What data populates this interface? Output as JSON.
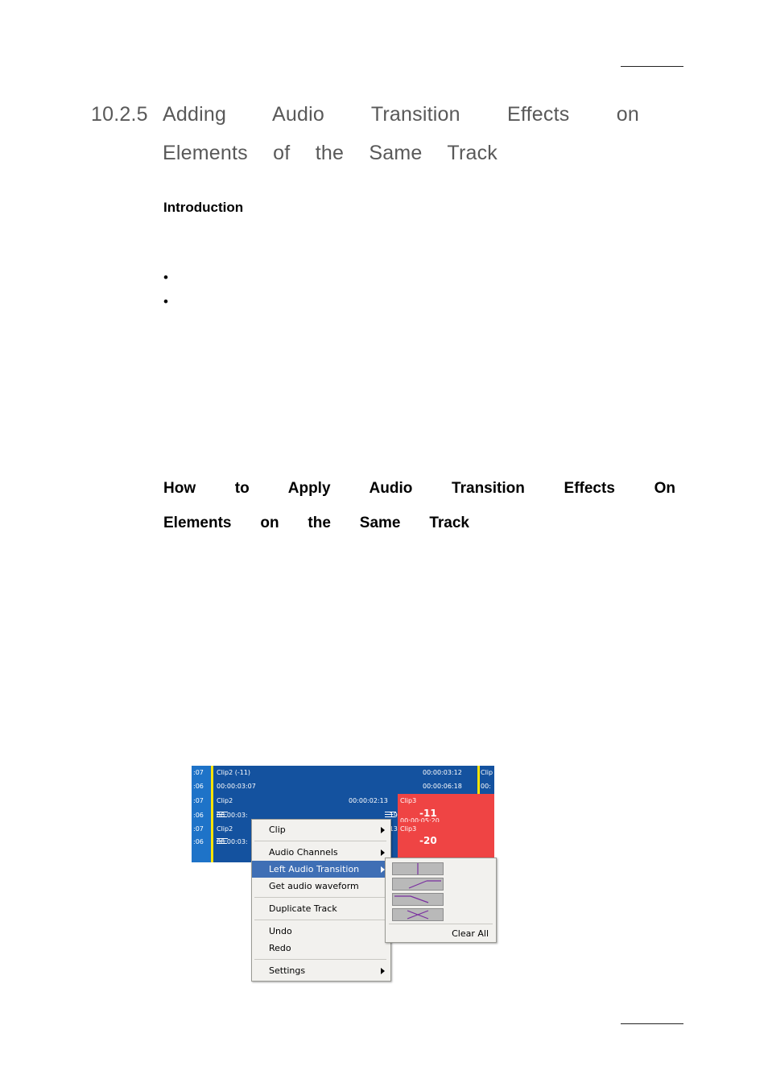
{
  "page": {
    "heading": {
      "number": "10.2.5",
      "line1": "Adding Audio Transition Effects on",
      "line2": "Elements of the Same Track"
    },
    "introduction_label": "Introduction",
    "bullets": [
      "",
      ""
    ],
    "howto": {
      "line1": "How to Apply Audio Transition Effects On",
      "line2": "Elements on the Same Track"
    }
  },
  "figure": {
    "timeline": {
      "row1": {
        "left_time": ":07",
        "clip_label": "Clip2 (-11)",
        "right_time": "00:00:03:12",
        "far_right": "Clip"
      },
      "row2": {
        "left_time": ":06",
        "mid_time": "00:00:03:07",
        "right_time": "00:00:06:18",
        "far_right": "00:"
      },
      "row3": {
        "left_time": ":07",
        "clip_label": "Clip2",
        "right_time": "00:00:02:13",
        "red_label": "Clip3"
      },
      "row4": {
        "left_time": ":06",
        "mid_time": "00:00:03:",
        "right_time": ":19",
        "red_value": "-11",
        "red_time": "00:00:05:20"
      },
      "row5": {
        "left_time": ":07",
        "clip_label": "Clip2",
        "right_time": ":13",
        "red_label": "Clip3"
      },
      "row6": {
        "left_time": ":06",
        "mid_time": "00:00:03:",
        "red_value": "-20"
      }
    },
    "context_menu": {
      "items": [
        {
          "label": "Clip",
          "submenu": true,
          "highlighted": false
        },
        {
          "label": "Audio Channels",
          "submenu": true,
          "highlighted": false
        },
        {
          "label": "Left Audio Transition",
          "submenu": true,
          "highlighted": true
        },
        {
          "label": "Get audio waveform",
          "submenu": false,
          "highlighted": false
        },
        {
          "label": "Duplicate Track",
          "submenu": false,
          "highlighted": false
        },
        {
          "label": "Undo",
          "submenu": false,
          "highlighted": false
        },
        {
          "label": "Redo",
          "submenu": false,
          "highlighted": false
        },
        {
          "label": "Settings",
          "submenu": true,
          "highlighted": false
        }
      ]
    },
    "submenu": {
      "transition_icons": [
        "transition-cut-icon",
        "transition-fade-in-icon",
        "transition-fade-out-icon",
        "transition-cross-fade-icon"
      ],
      "clear_all_label": "Clear All"
    }
  }
}
